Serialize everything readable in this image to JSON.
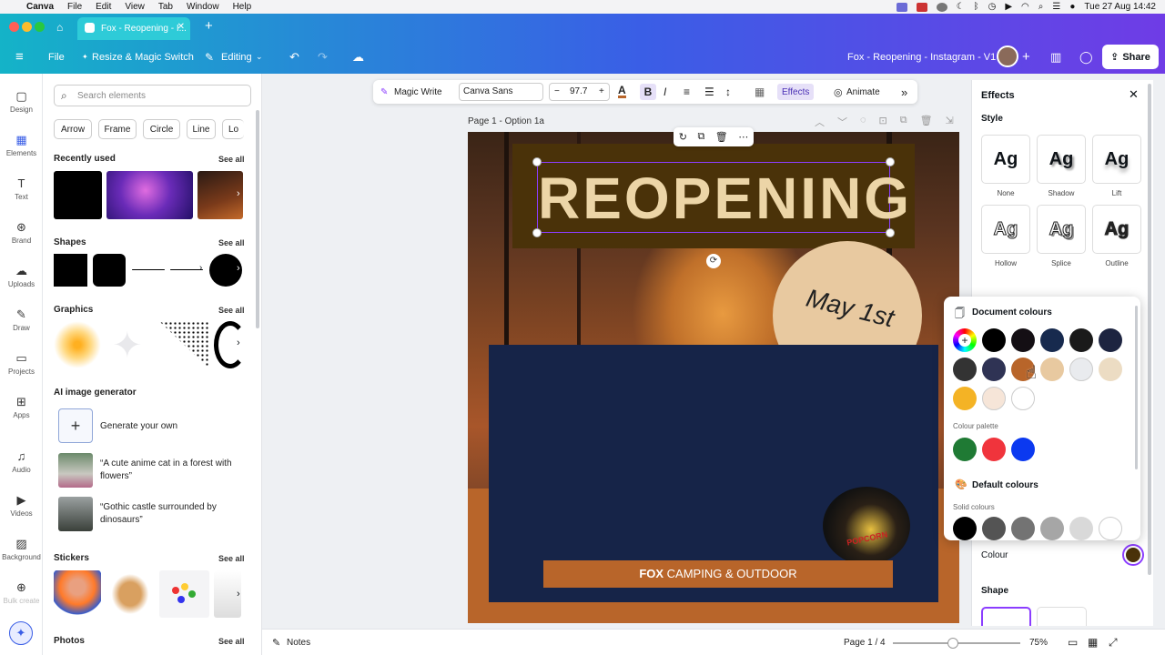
{
  "mac_menu": {
    "apple": "",
    "app": "Canva",
    "items": [
      "File",
      "Edit",
      "View",
      "Tab",
      "Window",
      "Help"
    ],
    "clock": "Tue 27 Aug  14:42"
  },
  "browser": {
    "tab_title": "Fox - Reopening - I...",
    "new_tab": "+"
  },
  "toolbar": {
    "menu_icon": "hamburger-icon",
    "file": "File",
    "resize": "Resize & Magic Switch",
    "editing": "Editing",
    "doc_title": "Fox - Reopening - Instagram - V1",
    "share": "Share"
  },
  "rail": [
    {
      "label": "Design",
      "icon": "design-icon"
    },
    {
      "label": "Elements",
      "icon": "elements-icon"
    },
    {
      "label": "Text",
      "icon": "text-icon"
    },
    {
      "label": "Brand",
      "icon": "brand-icon"
    },
    {
      "label": "Uploads",
      "icon": "uploads-icon"
    },
    {
      "label": "Draw",
      "icon": "draw-icon"
    },
    {
      "label": "Projects",
      "icon": "projects-icon"
    },
    {
      "label": "Apps",
      "icon": "apps-icon"
    },
    {
      "label": "Audio",
      "icon": "audio-icon"
    },
    {
      "label": "Videos",
      "icon": "videos-icon"
    },
    {
      "label": "Background",
      "icon": "background-icon"
    },
    {
      "label": "Bulk create",
      "icon": "bulk-create-icon"
    }
  ],
  "panel": {
    "search_placeholder": "Search elements",
    "chips": [
      "Arrow",
      "Frame",
      "Circle",
      "Line",
      "Lo"
    ],
    "recently_used": "Recently used",
    "shapes": "Shapes",
    "graphics": "Graphics",
    "ai_generator": "AI image generator",
    "generate_own": "Generate your own",
    "prompt1": "“A cute anime cat in a forest with flowers”",
    "prompt2": "“Gothic castle surrounded by dinosaurs”",
    "stickers": "Stickers",
    "photos": "Photos",
    "see_all": "See all"
  },
  "ctxbar": {
    "magic_write": "Magic Write",
    "font": "Canva Sans",
    "font_size": "97.7",
    "bold": "B",
    "italic": "I",
    "effects": "Effects",
    "animate": "Animate",
    "minus": "−",
    "plus": "+"
  },
  "page": {
    "label": "Page 1 - Option 1a"
  },
  "design": {
    "headline": "REOPENING",
    "date": "May 1st",
    "footer_bold": "FOX",
    "footer_rest": " CAMPING & OUTDOOR",
    "popcorn": "POPCORN"
  },
  "effects_panel": {
    "title": "Effects",
    "style": "Style",
    "styles": [
      {
        "label": "None"
      },
      {
        "label": "Shadow"
      },
      {
        "label": "Lift"
      },
      {
        "label": "Hollow"
      },
      {
        "label": "Splice"
      },
      {
        "label": "Outline"
      }
    ],
    "sample": "Ag",
    "colour_label": "Colour",
    "shape_label": "Shape"
  },
  "colour_popup": {
    "doc_colours": "Document colours",
    "palette": "Colour palette",
    "default_colours": "Default colours",
    "solid": "Solid colours",
    "document_swatches": [
      "#000000",
      "#140f14",
      "#172a4e",
      "#1a1a1a",
      "#1d2440",
      "#333333",
      "#2f3354",
      "#b8652a",
      "#e8c9a0",
      "#e9ebee",
      "#ecdcc3",
      "#f4b325",
      "#f6e5d8",
      "#ffffff"
    ],
    "palette_swatches": [
      "#1f7a34",
      "#f0343c",
      "#0b39f0"
    ],
    "solid_swatches": [
      "#000000",
      "#545454",
      "#737373",
      "#a6a6a6",
      "#d9d9d9",
      "#ffffff"
    ]
  },
  "bottom": {
    "notes": "Notes",
    "page": "Page 1 / 4",
    "zoom": "75%"
  },
  "colors": {
    "accent": "#8b3dff",
    "canva_teal": "#14b3c8",
    "navy": "#162448",
    "rust": "#b8652a",
    "headline_bg": "#4a3209",
    "headline_text": "#ecd5a7",
    "cream": "#e8c9a0"
  }
}
